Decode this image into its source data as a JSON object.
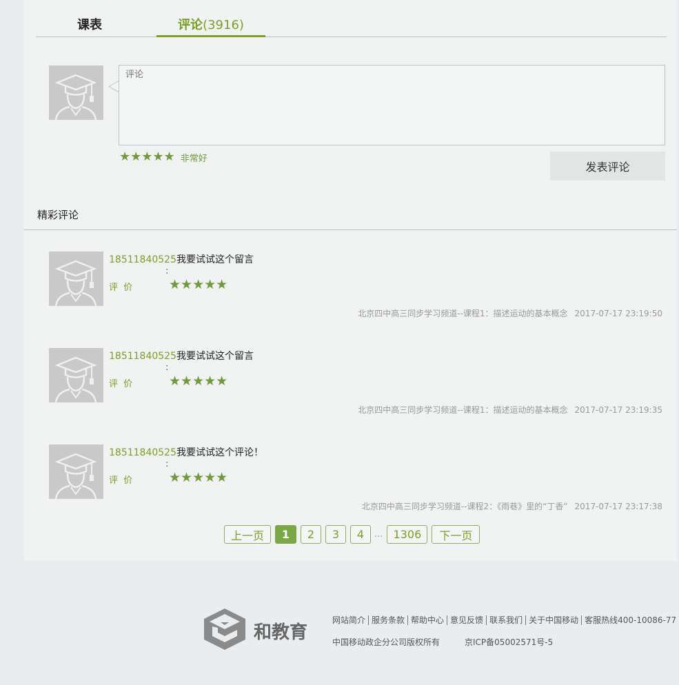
{
  "tabs": {
    "schedule": "课表",
    "comments_label": "评论",
    "comments_count": "(3916)"
  },
  "composer": {
    "placeholder": "评论",
    "stars": "★★★★★",
    "rating_text": "非常好",
    "submit_label": "发表评论"
  },
  "featured": {
    "title": "精彩评论"
  },
  "comments": [
    {
      "user": "18511840525",
      "text": "我要试试这个留言",
      "colon": ":",
      "rating_label": "评 价",
      "stars": "★★★★★",
      "course": "北京四中高三同步学习频道--课程1：描述运动的基本概念",
      "time": "2017-07-17 23:19:50"
    },
    {
      "user": "18511840525",
      "text": "我要试试这个留言",
      "colon": ":",
      "rating_label": "评 价",
      "stars": "★★★★★",
      "course": "北京四中高三同步学习频道--课程1：描述运动的基本概念",
      "time": "2017-07-17 23:19:35"
    },
    {
      "user": "18511840525",
      "text": "我要试试这个评论！",
      "colon": ":",
      "rating_label": "评 价",
      "stars": "★★★★★",
      "course": "北京四中高三同步学习频道--课程2：《雨巷》里的“丁香”",
      "time": "2017-07-17 23:17:38"
    }
  ],
  "pagination": {
    "prev": "上一页",
    "pages": [
      "1",
      "2",
      "3",
      "4"
    ],
    "current": "1",
    "ellipsis": "...",
    "last": "1306",
    "next": "下一页"
  },
  "footer": {
    "brand": "和教育",
    "links": [
      "网站简介",
      "服务条款",
      "帮助中心",
      "意见反馈",
      "联系我们",
      "关于中国移动",
      "客服热线400-10086-77"
    ],
    "copyright": "中国移动政企分公司版权所有",
    "icp": "京ICP备05002571号-5"
  },
  "colors": {
    "accent": "#7b9e24",
    "star": "#6f9a3e",
    "page_active": "#7ba747"
  },
  "icons": {
    "avatar": "graduate-avatar-icon",
    "logo": "he-education-logo-icon"
  }
}
